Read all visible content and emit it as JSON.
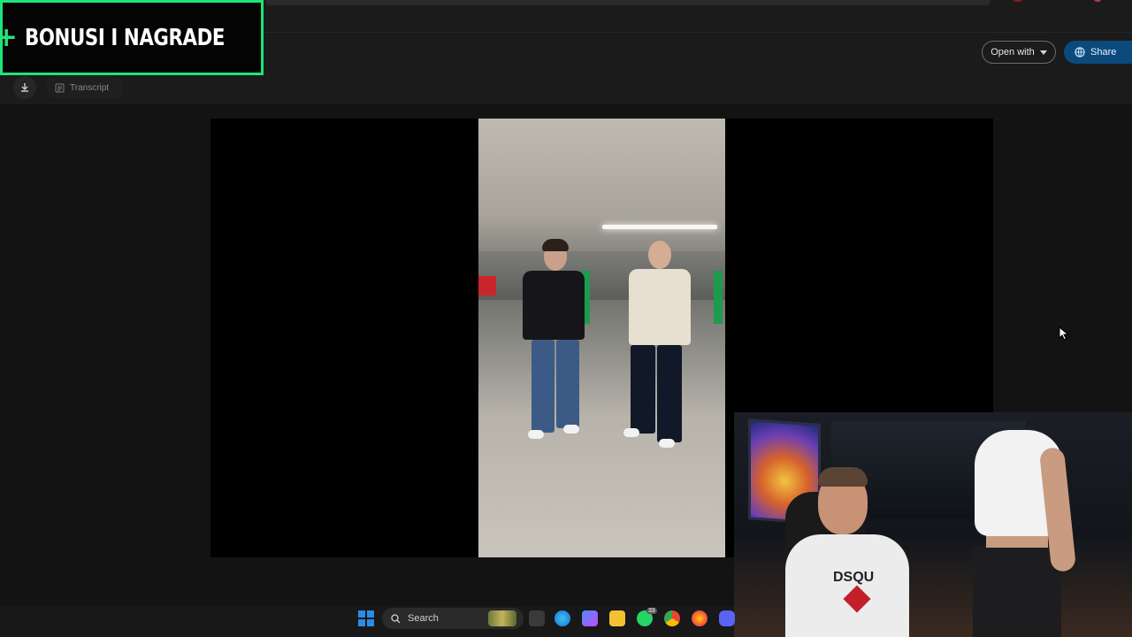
{
  "overlay": {
    "promo_plus": "+",
    "promo_text": "BONUSI I NAGRADE"
  },
  "header": {
    "open_with_label": "Open with",
    "share_label": "Share"
  },
  "subbar": {
    "transcript_label": "Transcript"
  },
  "webcam": {
    "shirt_text": "DSQU"
  },
  "taskbar": {
    "search_label": "Search",
    "badge_count": "33"
  },
  "colors": {
    "accent_green": "#1ee57a",
    "share_blue": "#0b4a7d",
    "start_blue": "#2b8ce6"
  },
  "icons": [
    "download-icon",
    "transcript-icon",
    "globe-icon",
    "caret-down-icon",
    "search-icon",
    "windows-start-icon",
    "edge-icon",
    "folder-icon",
    "whatsapp-icon",
    "chrome-icon",
    "firefox-icon",
    "discord-icon",
    "mouse-cursor-icon"
  ]
}
